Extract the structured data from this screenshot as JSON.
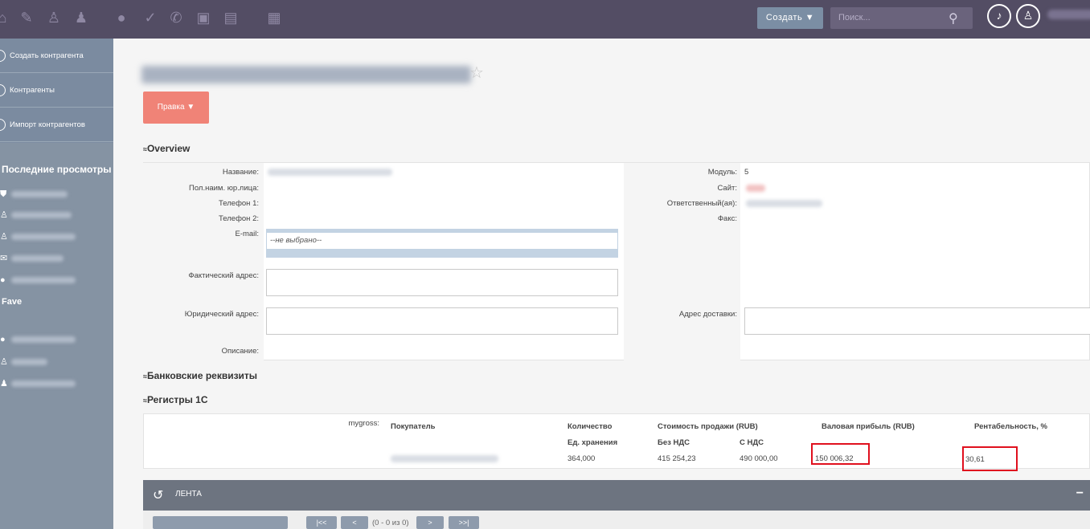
{
  "topbar": {
    "create_label": "Создать ▼",
    "search_placeholder": "Поиск...",
    "icons": [
      "home-icon",
      "edit-icon",
      "user-icon",
      "users-icon",
      "bulb-icon",
      "check-icon",
      "phone-icon",
      "book-icon",
      "calendar-icon",
      "grid-icon"
    ]
  },
  "sidebar": {
    "items": [
      {
        "label": "Создать контрагента"
      },
      {
        "label": "Контрагенты"
      },
      {
        "label": "Импорт контрагентов"
      }
    ],
    "recent_title": "Последние просмотры",
    "favorites_title": "Fave"
  },
  "record": {
    "edit_label": "Правка ▼"
  },
  "overview": {
    "header": "Overview",
    "labels": {
      "name": "Название:",
      "full_name": "Пол.наим. юр.лица:",
      "phone1": "Телефон 1:",
      "phone2": "Телефон 2:",
      "email": "E-mail:",
      "actual_address": "Фактический адрес:",
      "legal_address": "Юридический адрес:",
      "description": "Описание:",
      "module": "Модуль:",
      "site": "Сайт:",
      "responsible": "Ответственный(ая):",
      "fax": "Факс:",
      "delivery_address": "Адрес доставки:"
    },
    "module_value": "5",
    "email_value": "--не выбрано--"
  },
  "bank": {
    "header": "Банковские реквизиты"
  },
  "registers": {
    "header": "Регистры 1С",
    "row_label": "mygross:",
    "columns": [
      "Покупатель",
      "Количество",
      "Стоимость продажи (RUB)",
      "Валовая прибыль (RUB)",
      "Рентабельность, %"
    ],
    "sub_columns": [
      "Ед. хранения",
      "Без НДС",
      "С НДС"
    ],
    "row": {
      "quantity": "364,000",
      "sale_no_vat": "415 254,23",
      "sale_vat": "490 000,00",
      "gross_profit": "150 006,32",
      "profitability": "30,61"
    }
  },
  "feed": {
    "title": "ЛЕНТА",
    "minimize": "−",
    "pagination": {
      "first": "|<<",
      "prev": "<",
      "range": "(0 - 0 из 0)",
      "next": ">",
      "last": ">>|"
    }
  }
}
